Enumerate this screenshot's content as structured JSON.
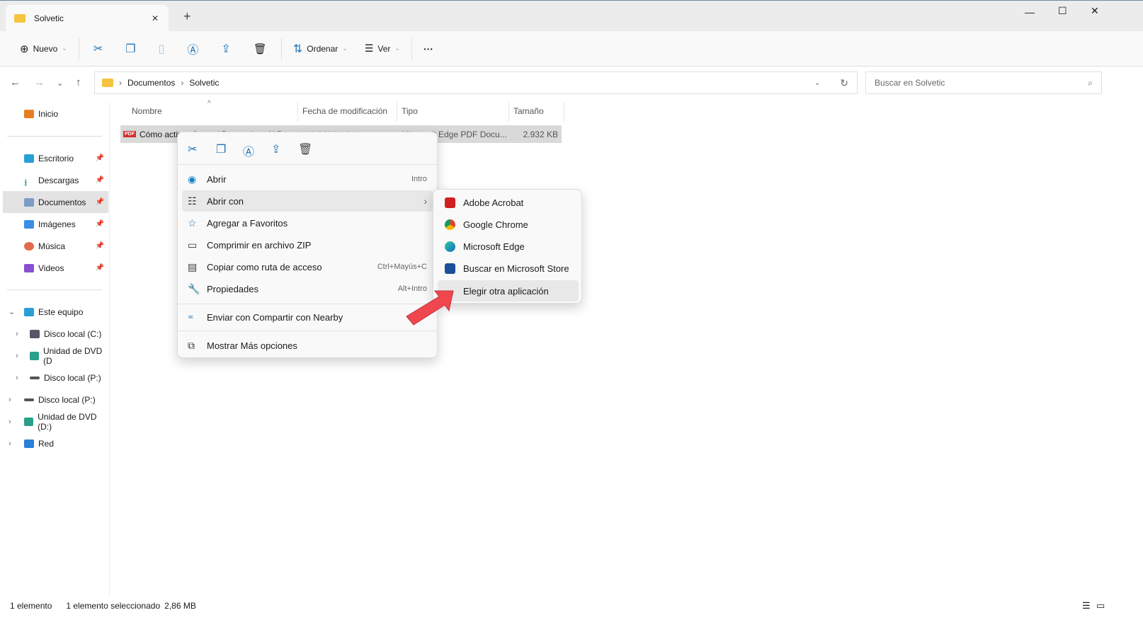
{
  "window": {
    "tab_title": "Solvetic",
    "new_tab": "+",
    "close_tab": "✕"
  },
  "toolbar": {
    "new": "Nuevo",
    "sort": "Ordenar",
    "view": "Ver",
    "more": "···"
  },
  "address": {
    "crumbs": [
      "Documentos",
      "Solvetic"
    ],
    "search_placeholder": "Buscar en Solvetic"
  },
  "sidebar": {
    "home": "Inicio",
    "quick": [
      "Escritorio",
      "Descargas",
      "Documentos",
      "Imágenes",
      "Música",
      "Videos"
    ],
    "this_pc": "Este equipo",
    "drives": [
      "Disco local (C:)",
      "Unidad de DVD (D",
      "Disco local (P:)"
    ],
    "roots": [
      "Disco local (P:)",
      "Unidad de DVD (D:)",
      "Red"
    ]
  },
  "columns": {
    "name": "Nombre",
    "date": "Fecha de modificación",
    "type": "Tipo",
    "size": "Tamaño"
  },
  "file": {
    "name": "Cómo activar Control Parental en Ai P",
    "date": "1/12/2022 1:24",
    "type": "Microsoft Edge PDF Docu...",
    "size": "2.932 KB"
  },
  "context_menu": {
    "items": [
      {
        "label": "Abrir",
        "shortcut": "Intro"
      },
      {
        "label": "Abrir con",
        "shortcut": "›"
      },
      {
        "label": "Agregar a Favoritos",
        "shortcut": ""
      },
      {
        "label": "Comprimir en archivo ZIP",
        "shortcut": ""
      },
      {
        "label": "Copiar como ruta de acceso",
        "shortcut": "Ctrl+Mayús+C"
      },
      {
        "label": "Propiedades",
        "shortcut": "Alt+Intro"
      },
      {
        "label": "Enviar con Compartir con Nearby",
        "shortcut": ""
      },
      {
        "label": "Mostrar Más opciones",
        "shortcut": ""
      }
    ]
  },
  "submenu": {
    "items": [
      "Adobe Acrobat",
      "Google Chrome",
      "Microsoft Edge",
      "Buscar en Microsoft Store",
      "Elegir otra aplicación"
    ]
  },
  "status": {
    "count": "1 elemento",
    "selected": "1 elemento seleccionado",
    "size": "2,86 MB"
  }
}
